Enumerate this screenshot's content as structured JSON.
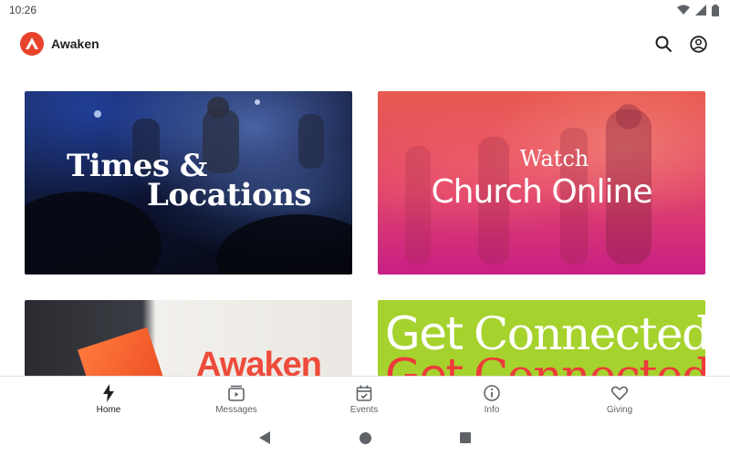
{
  "status_bar": {
    "time": "10:26"
  },
  "app": {
    "name": "Awaken"
  },
  "cards": {
    "times": {
      "line1": "Times &",
      "line2": "Locations"
    },
    "watch": {
      "small": "Watch",
      "big": "Church Online"
    },
    "awaken": {
      "word": "Awaken"
    },
    "connected": {
      "get": "Get",
      "connected": "Connected"
    }
  },
  "nav": {
    "items": [
      {
        "label": "Home",
        "icon": "lightning-icon",
        "active": true
      },
      {
        "label": "Messages",
        "icon": "media-icon",
        "active": false
      },
      {
        "label": "Events",
        "icon": "calendar-check-icon",
        "active": false
      },
      {
        "label": "Info",
        "icon": "info-icon",
        "active": false
      },
      {
        "label": "Giving",
        "icon": "heart-icon",
        "active": false
      }
    ]
  },
  "colors": {
    "brand": "#e8432b",
    "connected_green": "#a6d22e",
    "awaken_red": "#ee4b3a"
  }
}
